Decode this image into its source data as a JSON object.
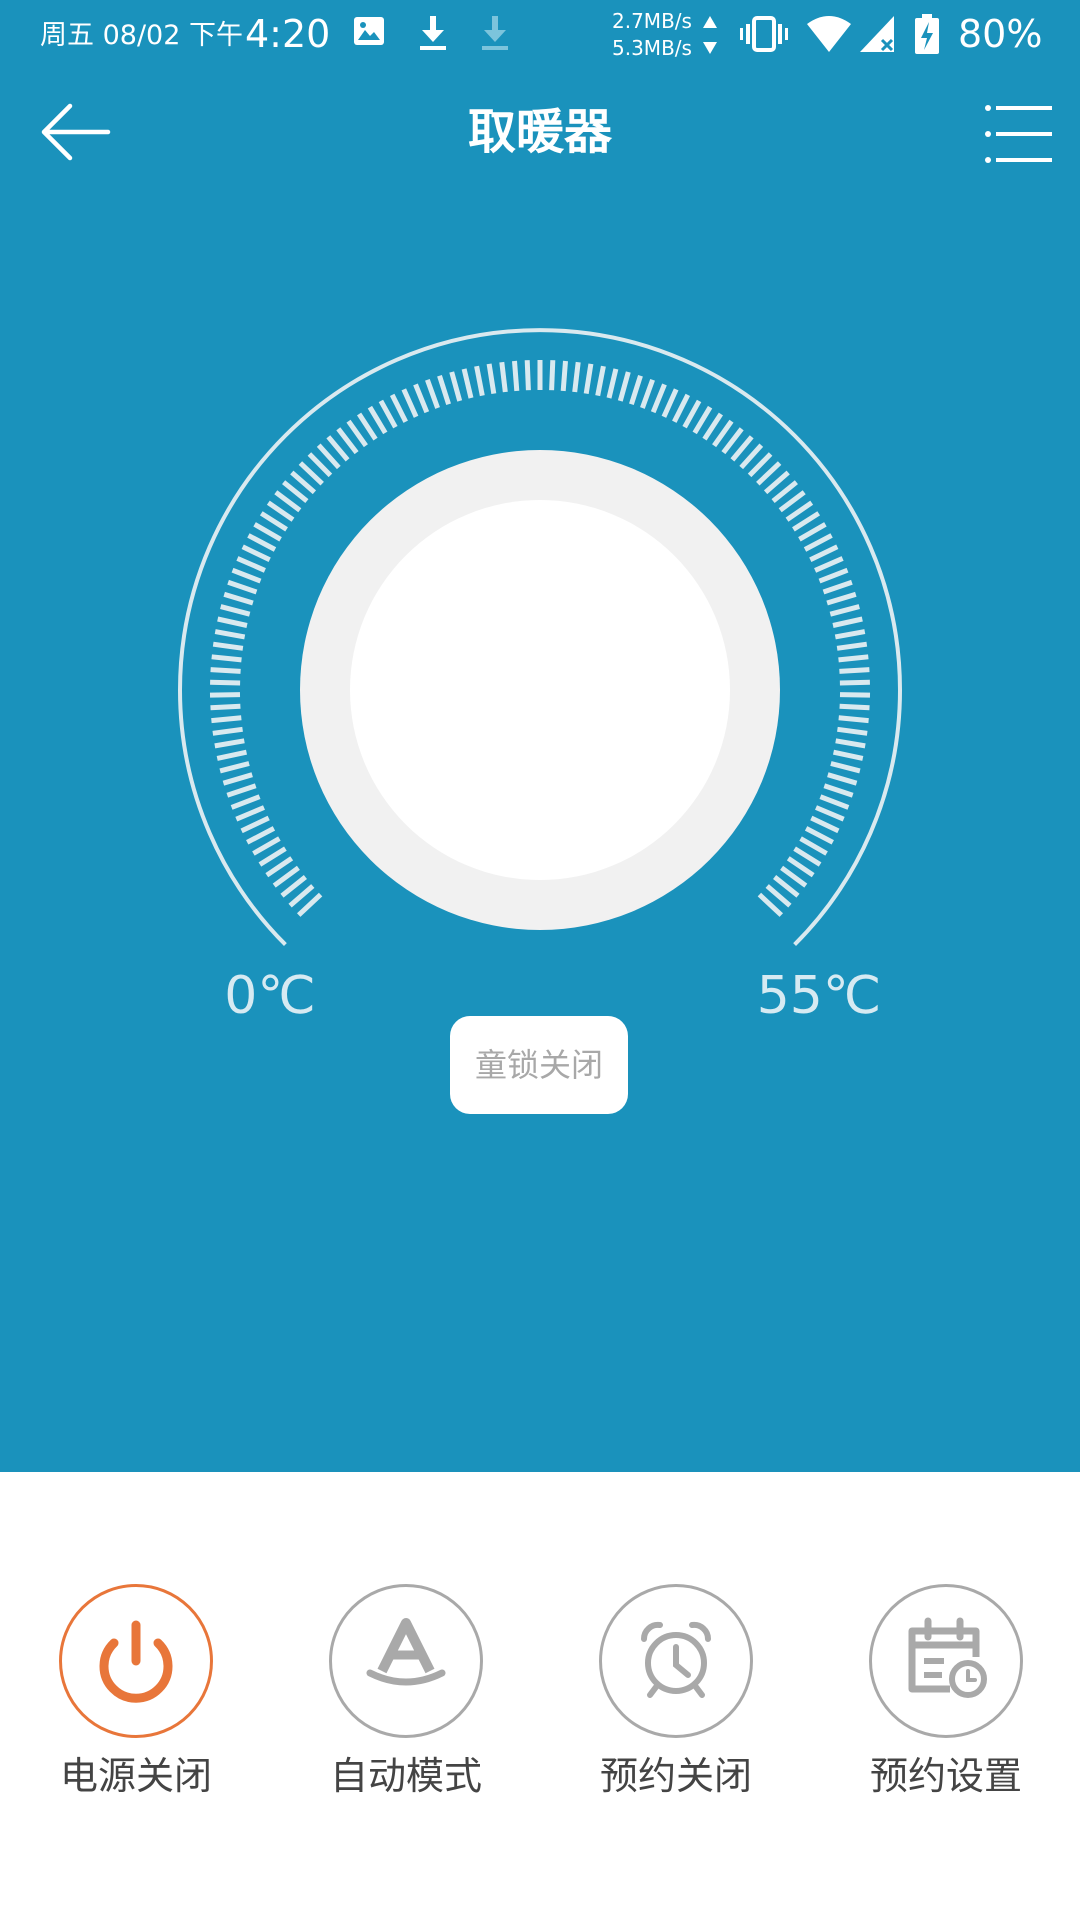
{
  "status_bar": {
    "date": "周五 08/02 下午",
    "time": "4:20",
    "speed_up": "2.7MB/s",
    "speed_down": "5.3MB/s",
    "battery": "80%",
    "icons": [
      "image-icon",
      "download-icon",
      "download-icon",
      "vibrate-icon",
      "wifi-icon",
      "signal-icon",
      "battery-charging-icon"
    ]
  },
  "header": {
    "title": "取暖器",
    "back_icon": "back-arrow-icon",
    "menu_icon": "menu-list-icon"
  },
  "dial": {
    "min_label": "0℃",
    "max_label": "55℃",
    "child_lock_label": "童锁关闭"
  },
  "controls": [
    {
      "label": "电源关闭",
      "icon": "power-icon",
      "active": true
    },
    {
      "label": "自动模式",
      "icon": "auto-mode-icon",
      "active": false
    },
    {
      "label": "预约关闭",
      "icon": "alarm-clock-icon",
      "active": false
    },
    {
      "label": "预约设置",
      "icon": "calendar-clock-icon",
      "active": false
    }
  ],
  "colors": {
    "primary_blue": "#1a92bc",
    "accent_orange": "#e8763a",
    "inactive_gray": "#a9a9a9"
  }
}
